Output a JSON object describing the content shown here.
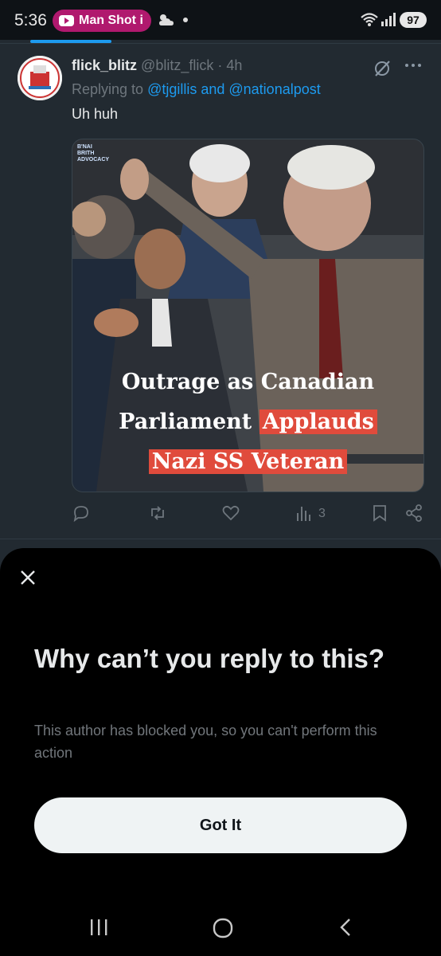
{
  "status_bar": {
    "time": "5:36",
    "recording_label": "Man Shot i",
    "battery": "97",
    "icons": [
      "youtube-icon",
      "weather-icon",
      "wifi-icon",
      "signal-icon",
      "battery-icon"
    ]
  },
  "tweet": {
    "author_name": "flick_blitz",
    "handle": "@blitz_flick",
    "separator": "·",
    "time": "4h",
    "replying_prefix": "Replying to",
    "mentions": "@tjgillis and @nationalpost",
    "text": "Uh huh",
    "media": {
      "watermark": [
        "B'NAI",
        "BRITH",
        "ADVOCACY"
      ],
      "caption_line1": "Outrage as Canadian",
      "caption_line2_plain": "Parliament",
      "caption_line2_highlight": "Applauds",
      "caption_line3_highlight": "Nazi SS Veteran"
    },
    "views": "3"
  },
  "sheet": {
    "title": "Why can’t you reply to this?",
    "body": "This author has blocked you, so you can't perform this action",
    "button": "Got It"
  },
  "colors": {
    "accent": "#1d9bf0",
    "highlight": "#e04b3c",
    "recording_pill": "#b0196e",
    "background": "#222a31",
    "sheet": "#000000"
  }
}
